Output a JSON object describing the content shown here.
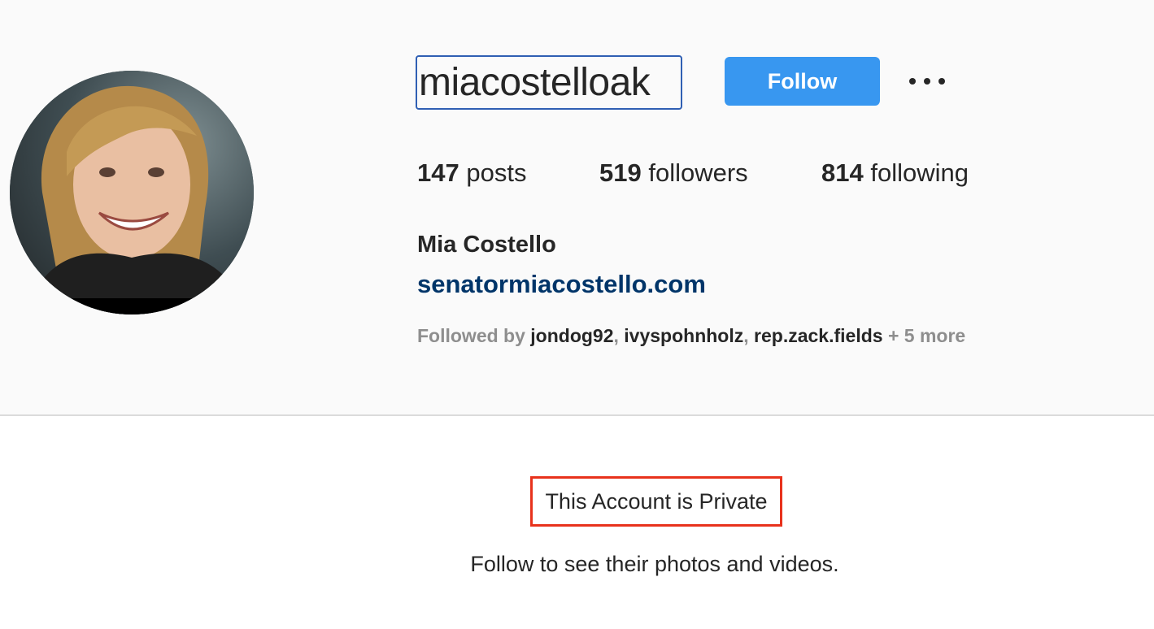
{
  "profile": {
    "username": "miacostelloak",
    "follow_label": "Follow",
    "stats": {
      "posts_count": "147",
      "posts_label": "posts",
      "followers_count": "519",
      "followers_label": "followers",
      "following_count": "814",
      "following_label": "following"
    },
    "full_name": "Mia Costello",
    "website": "senatormiacostello.com",
    "followed_by": {
      "prefix": "Followed by ",
      "names": [
        "jondog92",
        "ivyspohnholz",
        "rep.zack.fields"
      ],
      "separator": ", ",
      "suffix": " + 5 more"
    }
  },
  "private_notice": {
    "title": "This Account is Private",
    "subtitle": "Follow to see their photos and videos."
  },
  "icons": {
    "more": "more-options-icon"
  },
  "colors": {
    "follow_button": "#3897f0",
    "link": "#003569",
    "highlight_box": "#e8321c",
    "username_focus": "#2f5fb3"
  }
}
